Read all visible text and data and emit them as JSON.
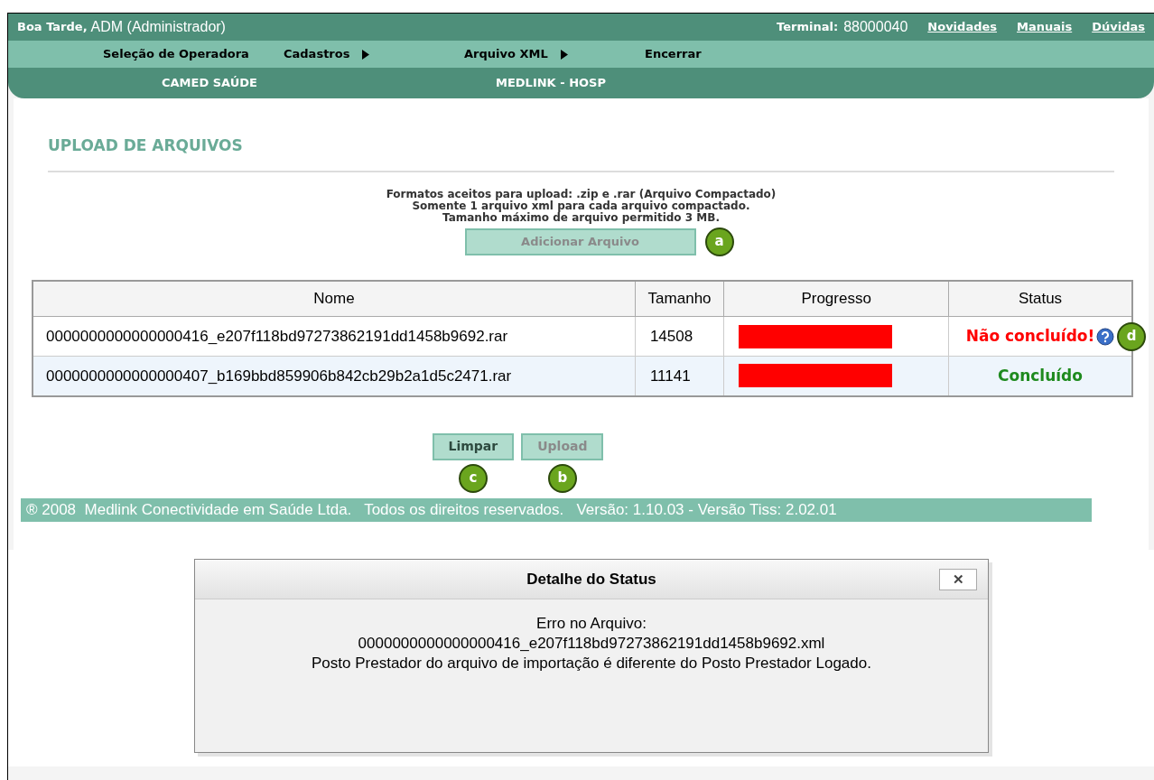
{
  "header": {
    "greeting": "Boa Tarde,",
    "user": "ADM (Administrador)",
    "terminal_label": "Terminal:",
    "terminal": "88000040",
    "links": [
      "Novidades",
      "Manuais",
      "Dúvidas"
    ]
  },
  "menu": [
    {
      "label": "Seleção de Operadora",
      "has_submenu": false
    },
    {
      "label": "Cadastros",
      "has_submenu": true
    },
    {
      "label": "Arquivo XML",
      "has_submenu": true
    },
    {
      "label": "Encerrar",
      "has_submenu": false
    }
  ],
  "context": {
    "operator": "CAMED SAÚDE",
    "provider": "MEDLINK - HOSP"
  },
  "page_title": "UPLOAD DE ARQUIVOS",
  "instructions": [
    "Formatos aceitos para upload: .zip e .rar (Arquivo Compactado)",
    "Somente 1 arquivo xml para cada arquivo compactado.",
    "Tamanho máximo de arquivo permitido 3 MB."
  ],
  "add_button": {
    "label": "Adicionar Arquivo",
    "disabled": true,
    "callout": "a"
  },
  "table": {
    "columns": [
      "Nome",
      "Tamanho",
      "Progresso",
      "Status"
    ],
    "rows": [
      {
        "name": "0000000000000000416_e207f118bd97273862191dd1458b9692.rar",
        "size": "14508",
        "status": {
          "kind": "error",
          "text": "Não concluído!",
          "callout": "d"
        }
      },
      {
        "name": "0000000000000000407_b169bbd859906b842cb29b2a1d5c2471.rar",
        "size": "11141",
        "status": {
          "kind": "done",
          "text": "Concluído"
        }
      }
    ]
  },
  "actions": [
    {
      "label": "Limpar",
      "disabled": false,
      "callout": "c"
    },
    {
      "label": "Upload",
      "disabled": true,
      "callout": "b"
    }
  ],
  "footer": "® 2008  Medlink Conectividade em Saúde Ltda.   Todos os direitos reservados.   Versão: 1.10.03 - Versão Tiss: 2.02.01",
  "dialog": {
    "title": "Detalhe do Status",
    "close": "✕",
    "lines": [
      "Erro no Arquivo:",
      "0000000000000000416_e207f118bd97273862191dd1458b9692.xml",
      "Posto Prestador do arquivo de importação é diferente do Posto Prestador Logado."
    ]
  }
}
